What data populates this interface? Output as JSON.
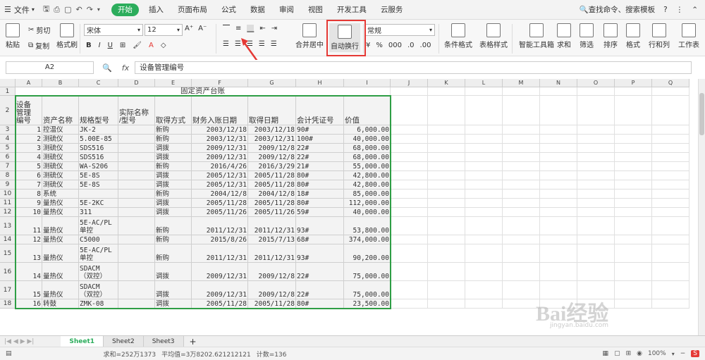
{
  "menu": {
    "file_label": "文件",
    "tabs": [
      "开始",
      "插入",
      "页面布局",
      "公式",
      "数据",
      "审阅",
      "视图",
      "开发工具",
      "云服务"
    ],
    "active_tab": 0,
    "search_label": "查找命令、搜索模板"
  },
  "ribbon": {
    "paste": "粘贴",
    "cut": "剪切",
    "copy": "复制",
    "format_painter": "格式刷",
    "font_name": "宋体",
    "font_size": "12",
    "merge_center": "合并居中",
    "wrap_text": "自动换行",
    "number_format": "常规",
    "conditional_format": "条件格式",
    "table_style": "表格样式",
    "smart_toolbox": "智能工具箱",
    "sum": "求和",
    "filter": "筛选",
    "sort": "排序",
    "format": "格式",
    "row_col": "行和列",
    "worksheet": "工作表"
  },
  "formula_bar": {
    "name_box": "A2",
    "fx": "fx",
    "content": "设备管理编号"
  },
  "columns": [
    "A",
    "B",
    "C",
    "D",
    "E",
    "F",
    "G",
    "H",
    "I",
    "J",
    "K",
    "L",
    "M",
    "N",
    "O",
    "P",
    "Q"
  ],
  "rows": [
    "1",
    "2",
    "3",
    "4",
    "5",
    "6",
    "7",
    "8",
    "9",
    "10",
    "11",
    "12",
    "13",
    "14",
    "15",
    "16",
    "17",
    "18"
  ],
  "table": {
    "title": "固定资产台账",
    "headers": [
      "设备\n管理\n编号",
      "资产名称",
      "规格型号",
      "实际名称\n/型号",
      "取得方式",
      "财务入账日期",
      "取得日期",
      "会计凭证号",
      "价值"
    ],
    "rows": [
      [
        "1",
        "控温仪",
        "JK-2",
        "",
        "新购",
        "2003/12/18",
        "2003/12/18",
        "90#",
        "6,000.00"
      ],
      [
        "2",
        "测硫仪",
        "5.00E-85",
        "",
        "新购",
        "2003/12/31",
        "2003/12/31",
        "100#",
        "40,000.00"
      ],
      [
        "3",
        "测硫仪",
        "SDS516",
        "",
        "调拨",
        "2009/12/31",
        "2009/12/8",
        "22#",
        "68,000.00"
      ],
      [
        "4",
        "测硫仪",
        "SDS516",
        "",
        "调拨",
        "2009/12/31",
        "2009/12/8",
        "22#",
        "68,000.00"
      ],
      [
        "5",
        "测硫仪",
        "WA-S206",
        "",
        "新购",
        "2016/4/26",
        "2016/3/29",
        "21#",
        "55,000.00"
      ],
      [
        "6",
        "测硫仪",
        "5E-8S",
        "",
        "调拨",
        "2005/12/31",
        "2005/11/28",
        "80#",
        "42,800.00"
      ],
      [
        "7",
        "测硫仪",
        "5E-8S",
        "",
        "调拨",
        "2005/12/31",
        "2005/11/28",
        "80#",
        "42,800.00"
      ],
      [
        "8",
        "系统",
        "",
        "",
        "新购",
        "2004/12/8",
        "2004/12/8",
        "18#",
        "85,000.00"
      ],
      [
        "9",
        "量热仪",
        "5E-2KC",
        "",
        "调拨",
        "2005/11/28",
        "2005/11/28",
        "80#",
        "112,000.00"
      ],
      [
        "10",
        "量热仪",
        "311",
        "",
        "调拨",
        "2005/11/26",
        "2005/11/26",
        "59#",
        "40,000.00"
      ],
      [
        "11",
        "量热仪",
        "5E-AC/PL\n单控",
        "",
        "新购",
        "2011/12/31",
        "2011/12/31",
        "93#",
        "53,800.00"
      ],
      [
        "12",
        "量热仪",
        "C5000",
        "",
        "新购",
        "2015/8/26",
        "2015/7/13",
        "68#",
        "374,000.00"
      ],
      [
        "13",
        "量热仪",
        "5E-AC/PL\n单控",
        "",
        "新购",
        "2011/12/31",
        "2011/12/31",
        "93#",
        "90,200.00"
      ],
      [
        "14",
        "量热仪",
        "SDACM\n（双控）",
        "",
        "调拨",
        "2009/12/31",
        "2009/12/8",
        "22#",
        "75,000.00"
      ],
      [
        "15",
        "量热仪",
        "SDACM\n（双控）",
        "",
        "调拨",
        "2009/12/31",
        "2009/12/8",
        "22#",
        "75,000.00"
      ],
      [
        "16",
        "转鼓",
        "ZMK-08",
        "",
        "调拨",
        "2005/11/28",
        "2005/11/28",
        "80#",
        "23,500.00"
      ]
    ]
  },
  "sheets": [
    "Sheet1",
    "Sheet2",
    "Sheet3"
  ],
  "status": {
    "sum": "求和=252万1373",
    "avg": "平均值=3万8202.621212121",
    "count": "计数=136",
    "zoom": "100%"
  },
  "watermark": {
    "main": "Bai经验",
    "sub": "jingyan.baidu.com"
  },
  "colors": {
    "accent": "#2cad5c",
    "highlight": "#e53935",
    "selection": "#2e9e45"
  }
}
